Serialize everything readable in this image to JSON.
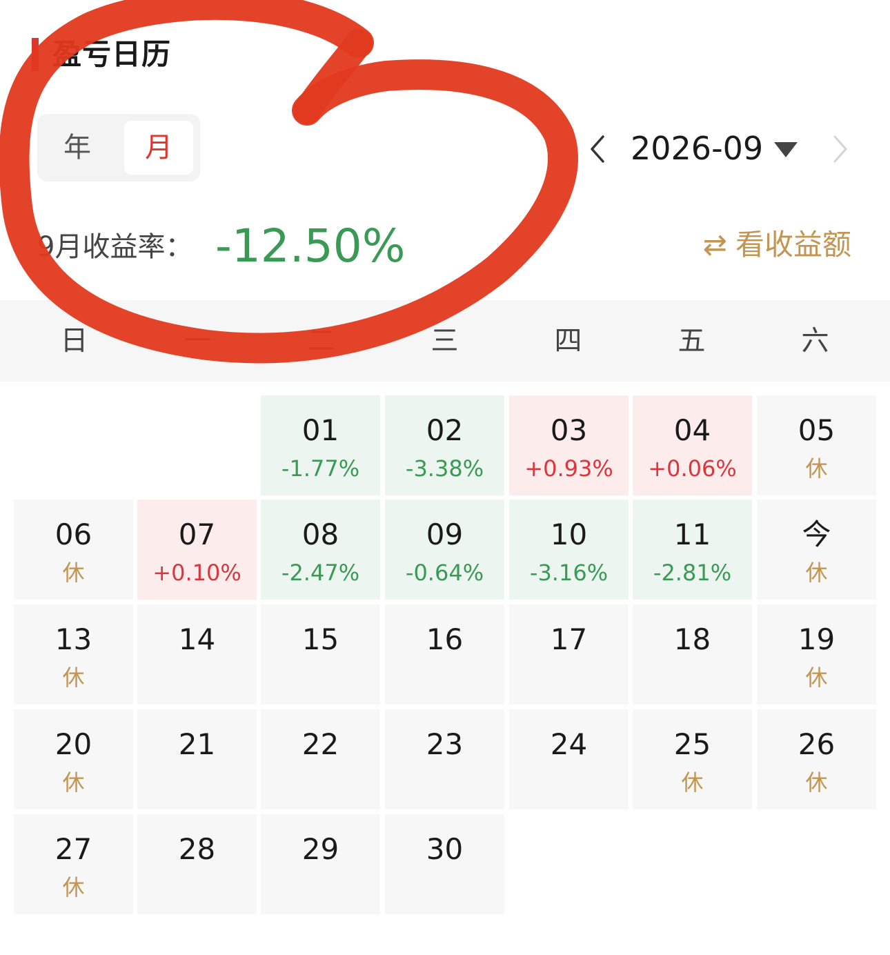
{
  "header": {
    "title": "盈亏日历"
  },
  "segment": {
    "year_label": "年",
    "month_label": "月",
    "selected": "月"
  },
  "month_nav": {
    "current": "2026-09"
  },
  "summary": {
    "label": "9月收益率：",
    "value": "-12.50%",
    "switch_label": "看收益额",
    "switch_icon": "swap-arrows-icon"
  },
  "weekdays": [
    "日",
    "一",
    "二",
    "三",
    "四",
    "五",
    "六"
  ],
  "days": [
    {
      "day": "01",
      "status": "-1.77%",
      "type": "down"
    },
    {
      "day": "02",
      "status": "-3.38%",
      "type": "down"
    },
    {
      "day": "03",
      "status": "+0.93%",
      "type": "up"
    },
    {
      "day": "04",
      "status": "+0.06%",
      "type": "up"
    },
    {
      "day": "05",
      "status": "休",
      "type": "rest"
    },
    {
      "day": "06",
      "status": "休",
      "type": "rest"
    },
    {
      "day": "07",
      "status": "+0.10%",
      "type": "up"
    },
    {
      "day": "08",
      "status": "-2.47%",
      "type": "down"
    },
    {
      "day": "09",
      "status": "-0.64%",
      "type": "down"
    },
    {
      "day": "10",
      "status": "-3.16%",
      "type": "down"
    },
    {
      "day": "11",
      "status": "-2.81%",
      "type": "down"
    },
    {
      "day": "今",
      "status": "休",
      "type": "rest"
    },
    {
      "day": "13",
      "status": "休",
      "type": "rest"
    },
    {
      "day": "14",
      "status": "",
      "type": "none"
    },
    {
      "day": "15",
      "status": "",
      "type": "none"
    },
    {
      "day": "16",
      "status": "",
      "type": "none"
    },
    {
      "day": "17",
      "status": "",
      "type": "none"
    },
    {
      "day": "18",
      "status": "",
      "type": "none"
    },
    {
      "day": "19",
      "status": "休",
      "type": "rest"
    },
    {
      "day": "20",
      "status": "休",
      "type": "rest"
    },
    {
      "day": "21",
      "status": "",
      "type": "none"
    },
    {
      "day": "22",
      "status": "",
      "type": "none"
    },
    {
      "day": "23",
      "status": "",
      "type": "none"
    },
    {
      "day": "24",
      "status": "",
      "type": "none"
    },
    {
      "day": "25",
      "status": "休",
      "type": "rest"
    },
    {
      "day": "26",
      "status": "休",
      "type": "rest"
    },
    {
      "day": "27",
      "status": "休",
      "type": "rest"
    },
    {
      "day": "28",
      "status": "",
      "type": "none"
    },
    {
      "day": "29",
      "status": "",
      "type": "none"
    },
    {
      "day": "30",
      "status": "",
      "type": "none"
    }
  ],
  "colors": {
    "accent": "#e0352b",
    "gain": "#d9363e",
    "loss": "#3a9a55",
    "rest": "#c29652",
    "annotation": "#e23a1e"
  }
}
